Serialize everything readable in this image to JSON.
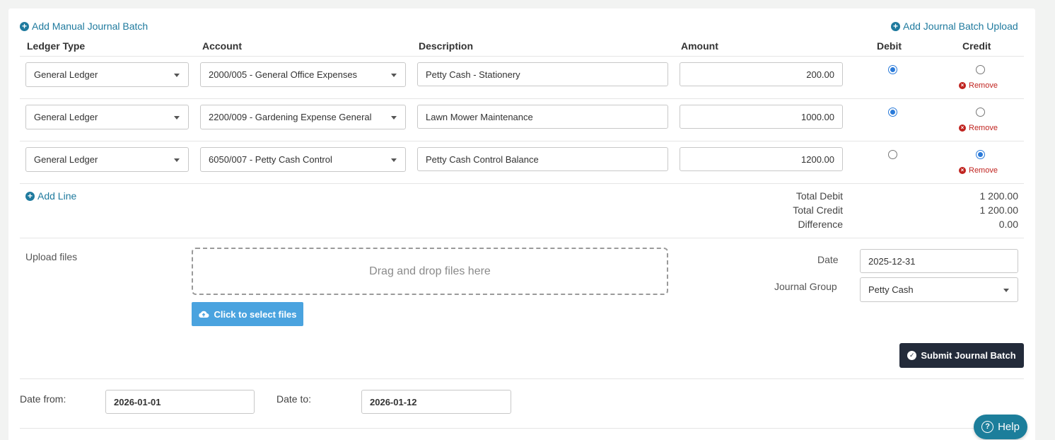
{
  "links": {
    "add_manual": "Add Manual Journal Batch",
    "add_upload": "Add Journal Batch Upload",
    "add_line": "Add Line"
  },
  "headers": {
    "ledger_type": "Ledger Type",
    "account": "Account",
    "description": "Description",
    "amount": "Amount",
    "debit": "Debit",
    "credit": "Credit"
  },
  "rows": [
    {
      "ledger": "General Ledger",
      "account": "2000/005 - General Office Expenses",
      "description": "Petty Cash - Stationery",
      "amount": "200.00",
      "side": "debit",
      "remove": "Remove"
    },
    {
      "ledger": "General Ledger",
      "account": "2200/009 - Gardening Expense General",
      "description": "Lawn Mower Maintenance",
      "amount": "1000.00",
      "side": "debit",
      "remove": "Remove"
    },
    {
      "ledger": "General Ledger",
      "account": "6050/007 - Petty Cash Control",
      "description": "Petty Cash Control Balance",
      "amount": "1200.00",
      "side": "credit",
      "remove": "Remove"
    }
  ],
  "totals": {
    "total_debit_label": "Total Debit",
    "total_debit": "1 200.00",
    "total_credit_label": "Total Credit",
    "total_credit": "1 200.00",
    "difference_label": "Difference",
    "difference": "0.00"
  },
  "upload": {
    "label": "Upload files",
    "dropzone": "Drag and drop files here",
    "button": "Click to select files"
  },
  "batch": {
    "date_label": "Date",
    "date": "2025-12-31",
    "group_label": "Journal Group",
    "group": "Petty Cash",
    "submit": "Submit Journal Batch"
  },
  "filter": {
    "from_label": "Date from:",
    "from": "2026-01-01",
    "to_label": "Date to:",
    "to": "2026-01-12"
  },
  "help": "Help"
}
